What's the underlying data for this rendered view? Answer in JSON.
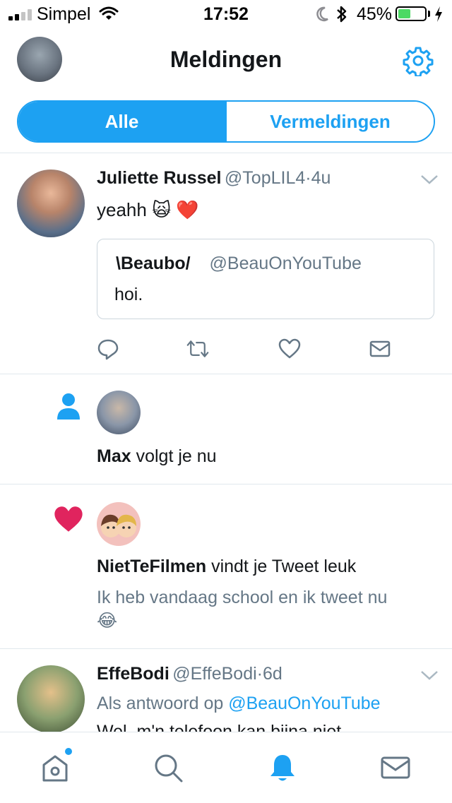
{
  "status_bar": {
    "carrier": "Simpel",
    "time": "17:52",
    "battery_pct": "45%",
    "battery_level": 0.45
  },
  "header": {
    "title": "Meldingen"
  },
  "tabs": {
    "all": "Alle",
    "mentions": "Vermeldingen"
  },
  "notifications": {
    "tweet": {
      "name": "Juliette Russel",
      "handle": "@TopLIL4",
      "sep": "·",
      "time": "4u",
      "text": "yeahh",
      "emoji": "🙀 ❤️",
      "quote": {
        "name": "\\Beaubo/",
        "handle": "@BeauOnYouTube",
        "text": "hoi."
      }
    },
    "follow": {
      "name": "Max",
      "action": " volgt je nu"
    },
    "like": {
      "name": "NietTeFilmen",
      "action": " vindt je Tweet leuk",
      "tweet_text": "Ik heb vandaag school en ik tweet nu",
      "emoji": "😂"
    },
    "reply": {
      "name": "EffeBodi",
      "handle": "@EffeBodi",
      "sep": "·",
      "time": "6d",
      "reply_prefix": "Als antwoord op ",
      "reply_to": "@BeauOnYouTube",
      "text": "Wel, m'n telefoon kan bijna niet"
    }
  },
  "colors": {
    "accent": "#1da1f2",
    "like": "#e0245e",
    "muted": "#657786"
  }
}
